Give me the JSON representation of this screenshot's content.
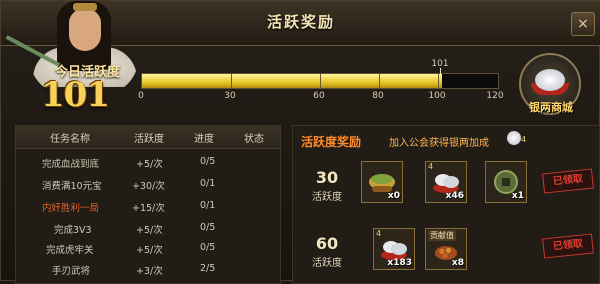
{
  "window": {
    "title": "活跃奖励",
    "close": "×"
  },
  "activity": {
    "label": "今日活跃度",
    "value": "101",
    "current": 101,
    "max": 120
  },
  "progress": {
    "ticks": [
      "0",
      "30",
      "60",
      "80",
      "100",
      "120"
    ],
    "marker": "101"
  },
  "shop": {
    "label": "银两商城"
  },
  "tasks": {
    "headers": [
      "任务名称",
      "活跃度",
      "进度",
      "状态"
    ],
    "rows": [
      {
        "name": "完成血战到底",
        "points": "+5/次",
        "progress": "0/5",
        "status": ""
      },
      {
        "name": "消费满10元宝",
        "points": "+30/次",
        "progress": "0/1",
        "status": ""
      },
      {
        "name": "内奸胜利一局",
        "points": "+15/次",
        "progress": "0/1",
        "status": ""
      },
      {
        "name": "完成3V3",
        "points": "+5/次",
        "progress": "0/5",
        "status": ""
      },
      {
        "name": "完成虎牢关",
        "points": "+5/次",
        "progress": "0/5",
        "status": ""
      },
      {
        "name": "手刃武将",
        "points": "+3/次",
        "progress": "2/5",
        "status": ""
      }
    ]
  },
  "rewards": {
    "title": "活跃度奖励",
    "hint": "加入公会获得银两加成",
    "hint_value": "4",
    "tiers": [
      {
        "points": "30",
        "label": "活跃度",
        "items": [
          {
            "icon": "bowl-icon",
            "qty": "x0",
            "badge": ""
          },
          {
            "icon": "silver-ingot-icon",
            "qty": "x46",
            "badge": "4"
          },
          {
            "icon": "coin-icon",
            "qty": "x1",
            "badge": ""
          }
        ],
        "status": "已领取"
      },
      {
        "points": "60",
        "label": "活跃度",
        "items": [
          {
            "icon": "silver-ingot-icon",
            "qty": "x183",
            "badge": "4"
          },
          {
            "icon": "contribution-chest-icon",
            "qty": "x8",
            "badge": "",
            "caption": "贡献值"
          }
        ],
        "status": "已领取"
      }
    ]
  }
}
